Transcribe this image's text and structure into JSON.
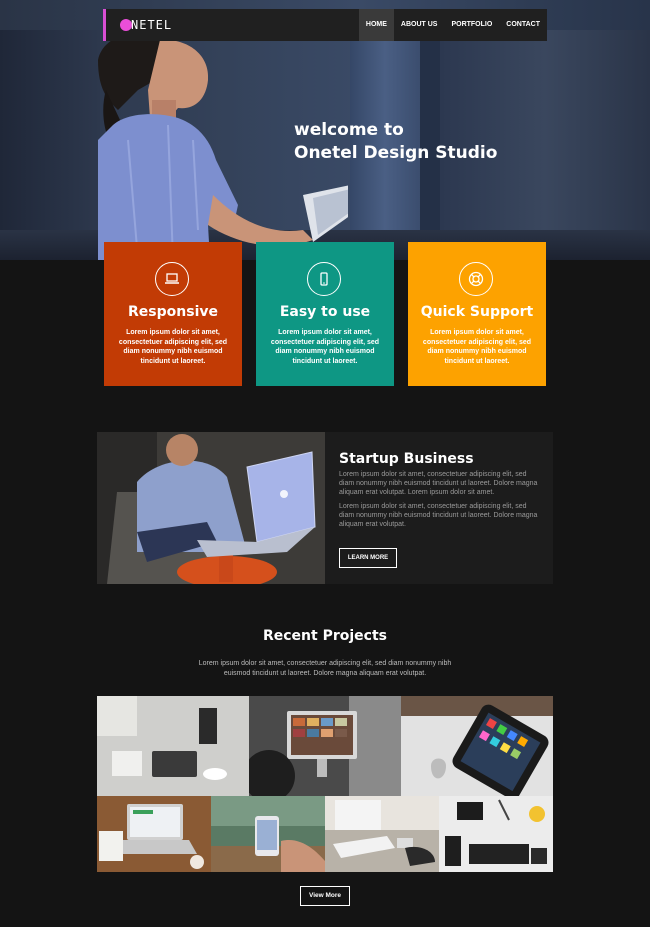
{
  "nav": {
    "logo_text": "NETEL",
    "items": [
      {
        "label": "HOME",
        "active": true
      },
      {
        "label": "ABOUT US",
        "active": false
      },
      {
        "label": "PORTFOLIO",
        "active": false
      },
      {
        "label": "CONTACT",
        "active": false
      }
    ]
  },
  "hero": {
    "line1": "welcome to",
    "line2": "Onetel Design Studio"
  },
  "features": [
    {
      "title": "Responsive",
      "icon": "laptop-icon",
      "color": "#c23b05",
      "text": "Lorem ipsum dolor sit amet, consectetuer adipiscing elit, sed diam nonummy nibh euismod tincidunt ut laoreet."
    },
    {
      "title": "Easy to use",
      "icon": "mobile-icon",
      "color": "#0e9784",
      "text": "Lorem ipsum dolor sit amet, consectetuer adipiscing elit, sed diam nonummy nibh euismod tincidunt ut laoreet."
    },
    {
      "title": "Quick Support",
      "icon": "lifebuoy-icon",
      "color": "#fda200",
      "text": "Lorem ipsum dolor sit amet, consectetuer adipiscing elit, sed diam nonummy nibh euismod tincidunt ut laoreet."
    }
  ],
  "about": {
    "title": "Startup Business",
    "p1": "Lorem ipsum dolor sit amet, consectetuer adipiscing elit, sed diam nonummy nibh euismod tincidunt ut laoreet. Dolore magna aliquam erat volutpat. Lorem ipsum dolor sit amet.",
    "p2": "Lorem ipsum dolor sit amet, consectetuer adipiscing elit, sed diam nonummy nibh euismod tincidunt ut laoreet. Dolore magna aliquam erat volutpat.",
    "button": "LEARN MORE"
  },
  "projects": {
    "title": "Recent Projects",
    "text": "Lorem ipsum dolor sit amet, consectetuer adipiscing elit, sed diam nonummy nibh euismod tincidunt ut laoreet. Dolore magna aliquam erat volutpat.",
    "button": "View More"
  },
  "colors": {
    "accent": "#d94fd4",
    "responsive": "#c23b05",
    "easy": "#0e9784",
    "support": "#fda200"
  }
}
